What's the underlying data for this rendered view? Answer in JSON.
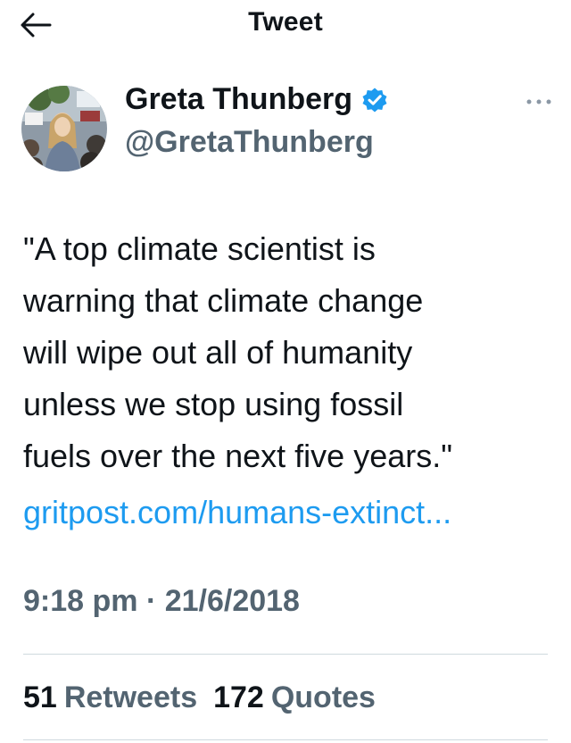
{
  "header": {
    "title": "Tweet",
    "back_icon": "arrow-left-icon"
  },
  "author": {
    "name": "Greta Thunberg",
    "handle": "@GretaThunberg",
    "verified_icon": "verified-badge-icon",
    "verified_color": "#1d9bf0"
  },
  "more_icon": "more-horizontal-icon",
  "tweet": {
    "text": "\"A top climate scientist is\nwarning that climate change\nwill wipe out all of humanity\nunless we stop using fossil\nfuels over the next five years.\"",
    "link": "gritpost.com/humans-extinct...",
    "link_color": "#1d9bf0"
  },
  "meta": {
    "timestamp": "9:18 pm · 21/6/2018"
  },
  "stats": {
    "retweets_count": "51",
    "retweets_label": "Retweets",
    "quotes_count": "172",
    "quotes_label": "Quotes"
  }
}
